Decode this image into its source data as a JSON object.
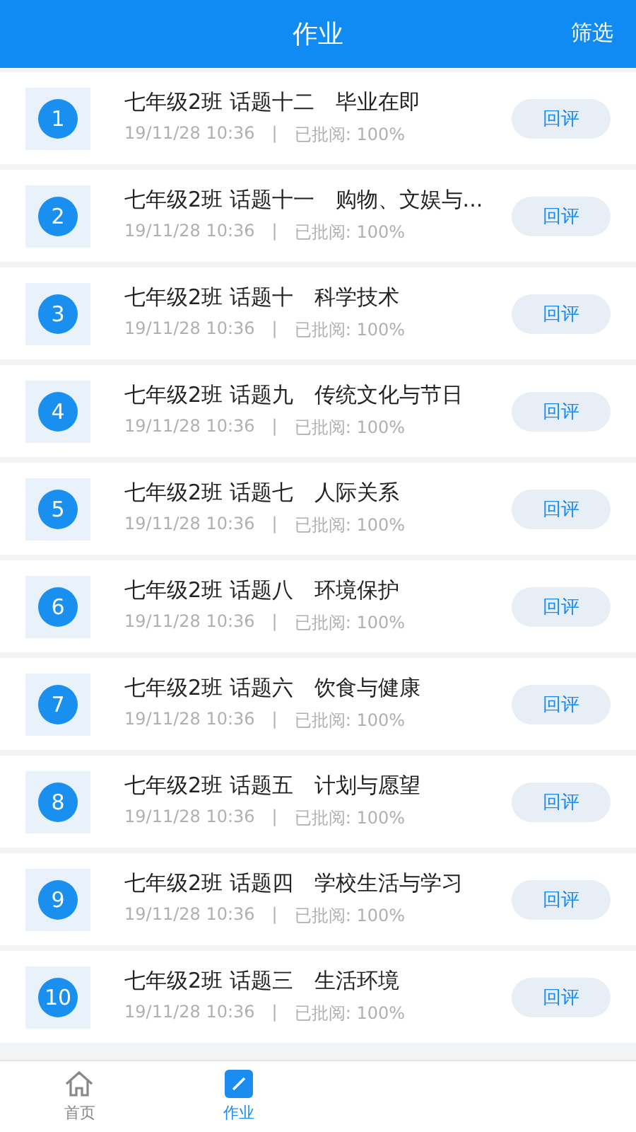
{
  "header": {
    "title": "作业",
    "action": "筛选"
  },
  "assignments": [
    {
      "number": "1",
      "title": "七年级2班 话题十二　毕业在即",
      "date": "19/11/28 10:36",
      "separator": "|",
      "status": "已批阅:  100%",
      "button": "回评"
    },
    {
      "number": "2",
      "title": "七年级2班 话题十一　购物、文娱与...",
      "date": "19/11/28 10:36",
      "separator": "|",
      "status": "已批阅:  100%",
      "button": "回评"
    },
    {
      "number": "3",
      "title": "七年级2班 话题十　科学技术",
      "date": "19/11/28 10:36",
      "separator": "|",
      "status": "已批阅:  100%",
      "button": "回评"
    },
    {
      "number": "4",
      "title": "七年级2班 话题九　传统文化与节日",
      "date": "19/11/28 10:36",
      "separator": "|",
      "status": "已批阅:  100%",
      "button": "回评"
    },
    {
      "number": "5",
      "title": "七年级2班 话题七　人际关系",
      "date": "19/11/28 10:36",
      "separator": "|",
      "status": "已批阅:  100%",
      "button": "回评"
    },
    {
      "number": "6",
      "title": "七年级2班 话题八　环境保护",
      "date": "19/11/28 10:36",
      "separator": "|",
      "status": "已批阅:  100%",
      "button": "回评"
    },
    {
      "number": "7",
      "title": "七年级2班 话题六　饮食与健康",
      "date": "19/11/28 10:36",
      "separator": "|",
      "status": "已批阅:  100%",
      "button": "回评"
    },
    {
      "number": "8",
      "title": "七年级2班 话题五　计划与愿望",
      "date": "19/11/28 10:36",
      "separator": "|",
      "status": "已批阅:  100%",
      "button": "回评"
    },
    {
      "number": "9",
      "title": "七年级2班 话题四　学校生活与学习",
      "date": "19/11/28 10:36",
      "separator": "|",
      "status": "已批阅:  100%",
      "button": "回评"
    },
    {
      "number": "10",
      "title": "七年级2班 话题三　生活环境",
      "date": "19/11/28 10:36",
      "separator": "|",
      "status": "已批阅:  100%",
      "button": "回评"
    }
  ],
  "tabs": [
    {
      "label": "首页",
      "kind": "home",
      "selected": false
    },
    {
      "label": "作业",
      "kind": "homework",
      "selected": true
    }
  ]
}
